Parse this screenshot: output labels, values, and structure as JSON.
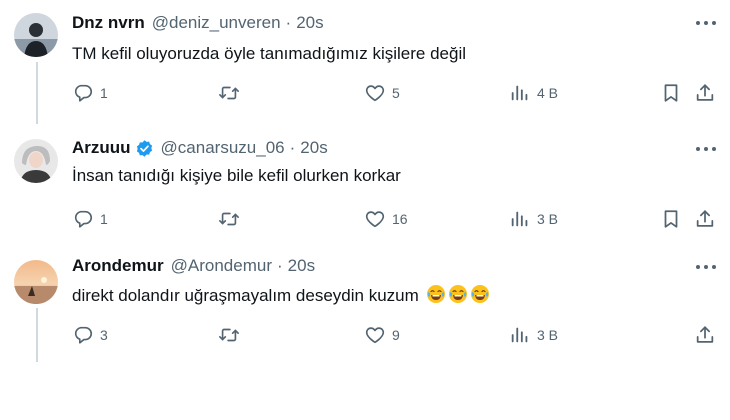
{
  "tweets": [
    {
      "display_name": "Dnz nvrn",
      "handle": "@deniz_unveren",
      "separator": "·",
      "time": "20s",
      "text": "TM kefil oluyoruzda öyle tanımadığımız kişilere değil",
      "replies": "1",
      "retweets": "",
      "likes": "5",
      "views": "4 B",
      "verified": false
    },
    {
      "display_name": "Arzuuu",
      "handle": "@canarsuzu_06",
      "separator": "·",
      "time": "20s",
      "text": "İnsan tanıdığı kişiye bile kefil olurken korkar",
      "replies": "1",
      "retweets": "",
      "likes": "16",
      "views": "3 B",
      "verified": true
    },
    {
      "display_name": "Arondemur",
      "handle": "@Arondemur",
      "separator": "·",
      "time": "20s",
      "text": "direkt dolandır uğraşmayalım deseydin kuzum",
      "text_emoji": "face-with-tears-of-joy ×3",
      "replies": "3",
      "retweets": "",
      "likes": "9",
      "views": "3 B",
      "verified": false
    }
  ],
  "colors": {
    "text_primary": "#0f1419",
    "text_secondary": "#536471",
    "verified_blue": "#1d9bf0",
    "thread_line": "#cfd9de"
  },
  "icons": [
    "reply-icon",
    "retweet-icon",
    "like-icon",
    "views-icon",
    "bookmark-icon",
    "share-icon",
    "more-icon",
    "verified-badge-icon",
    "tears-of-joy-emoji"
  ]
}
